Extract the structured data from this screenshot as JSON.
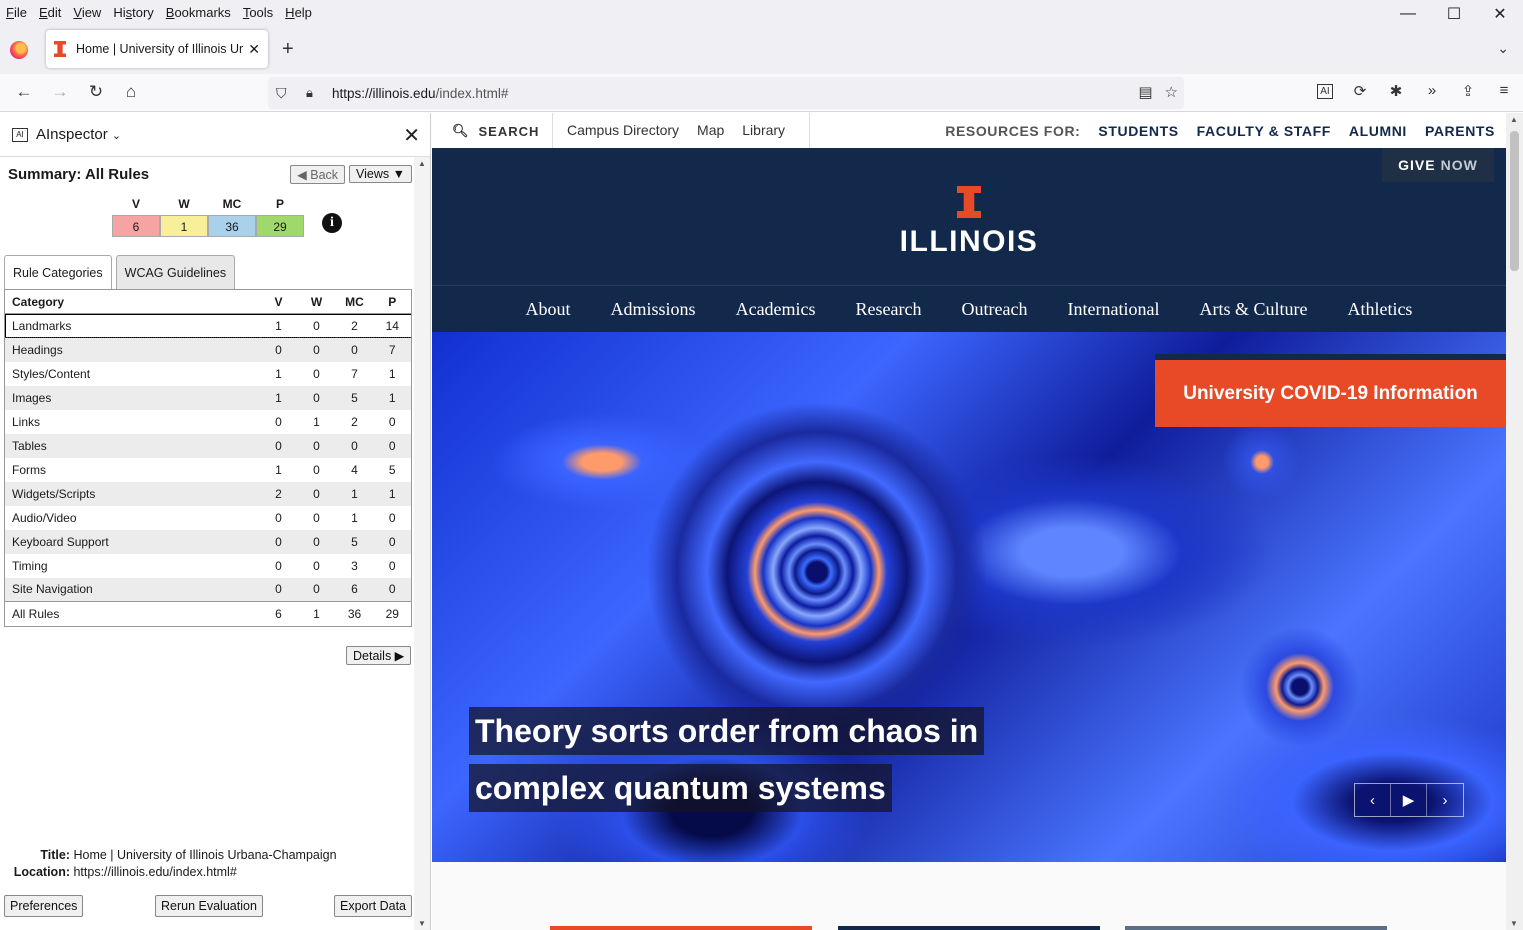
{
  "browser": {
    "menu": [
      {
        "label": "File",
        "key": "F",
        "rest": "ile"
      },
      {
        "label": "Edit",
        "key": "E",
        "rest": "dit"
      },
      {
        "label": "View",
        "key": "V",
        "rest": "iew"
      },
      {
        "label": "History",
        "key": "s",
        "pre": "Hi",
        "rest": "tory"
      },
      {
        "label": "Bookmarks",
        "key": "B",
        "rest": "ookmarks"
      },
      {
        "label": "Tools",
        "key": "T",
        "rest": "ools"
      },
      {
        "label": "Help",
        "key": "H",
        "rest": "elp"
      }
    ],
    "tab_title": "Home | University of Illinois Urbana-Champaign",
    "url_host": "https://illinois.edu",
    "url_path": "/index.html#",
    "window_controls": {
      "minimize": "—",
      "maximize": "☐",
      "close": "✕"
    }
  },
  "sidebar": {
    "title": "AInspector",
    "summary_title": "Summary: All Rules",
    "back_label": "◀ Back",
    "views_label": "Views ▼",
    "counts": [
      {
        "label": "V",
        "value": "6",
        "color": "#f5a3a3"
      },
      {
        "label": "W",
        "value": "1",
        "color": "#f9ef9a"
      },
      {
        "label": "MC",
        "value": "36",
        "color": "#a9d1ea"
      },
      {
        "label": "P",
        "value": "29",
        "color": "#9fd86b"
      }
    ],
    "tabs": [
      "Rule Categories",
      "WCAG Guidelines"
    ],
    "table_headers": [
      "Category",
      "V",
      "W",
      "MC",
      "P"
    ],
    "rows": [
      {
        "category": "Landmarks",
        "v": "1",
        "w": "0",
        "mc": "2",
        "p": "14"
      },
      {
        "category": "Headings",
        "v": "0",
        "w": "0",
        "mc": "0",
        "p": "7"
      },
      {
        "category": "Styles/Content",
        "v": "1",
        "w": "0",
        "mc": "7",
        "p": "1"
      },
      {
        "category": "Images",
        "v": "1",
        "w": "0",
        "mc": "5",
        "p": "1"
      },
      {
        "category": "Links",
        "v": "0",
        "w": "1",
        "mc": "2",
        "p": "0"
      },
      {
        "category": "Tables",
        "v": "0",
        "w": "0",
        "mc": "0",
        "p": "0"
      },
      {
        "category": "Forms",
        "v": "1",
        "w": "0",
        "mc": "4",
        "p": "5"
      },
      {
        "category": "Widgets/Scripts",
        "v": "2",
        "w": "0",
        "mc": "1",
        "p": "1"
      },
      {
        "category": "Audio/Video",
        "v": "0",
        "w": "0",
        "mc": "1",
        "p": "0"
      },
      {
        "category": "Keyboard Support",
        "v": "0",
        "w": "0",
        "mc": "5",
        "p": "0"
      },
      {
        "category": "Timing",
        "v": "0",
        "w": "0",
        "mc": "3",
        "p": "0"
      },
      {
        "category": "Site Navigation",
        "v": "0",
        "w": "0",
        "mc": "6",
        "p": "0"
      }
    ],
    "total": {
      "category": "All Rules",
      "v": "6",
      "w": "1",
      "mc": "36",
      "p": "29"
    },
    "details_label": "Details ▶",
    "title_label": "Title:",
    "title_value": "Home | University of Illinois Urbana-Champaign",
    "location_label": "Location:",
    "location_value": "https://illinois.edu/index.html#",
    "preferences_label": "Preferences",
    "rerun_label": "Rerun Evaluation",
    "export_label": "Export Data"
  },
  "page": {
    "search_label": "SEARCH",
    "utility_links": [
      "Campus Directory",
      "Map",
      "Library"
    ],
    "resources_label": "RESOURCES FOR:",
    "resources": [
      "STUDENTS",
      "FACULTY & STAFF",
      "ALUMNI",
      "PARENTS"
    ],
    "give_label": "GIVE",
    "now_label": "NOW",
    "wordmark": "ILLINOIS",
    "nav": [
      "About",
      "Admissions",
      "Academics",
      "Research",
      "Outreach",
      "International",
      "Arts & Culture",
      "Athletics"
    ],
    "covid_label": "University COVID-19 Information",
    "headline_line1": "Theory sorts order from chaos in",
    "headline_line2": "complex quantum systems",
    "colors": {
      "illinois_blue": "#13294b",
      "illinois_orange": "#e84a27"
    }
  }
}
